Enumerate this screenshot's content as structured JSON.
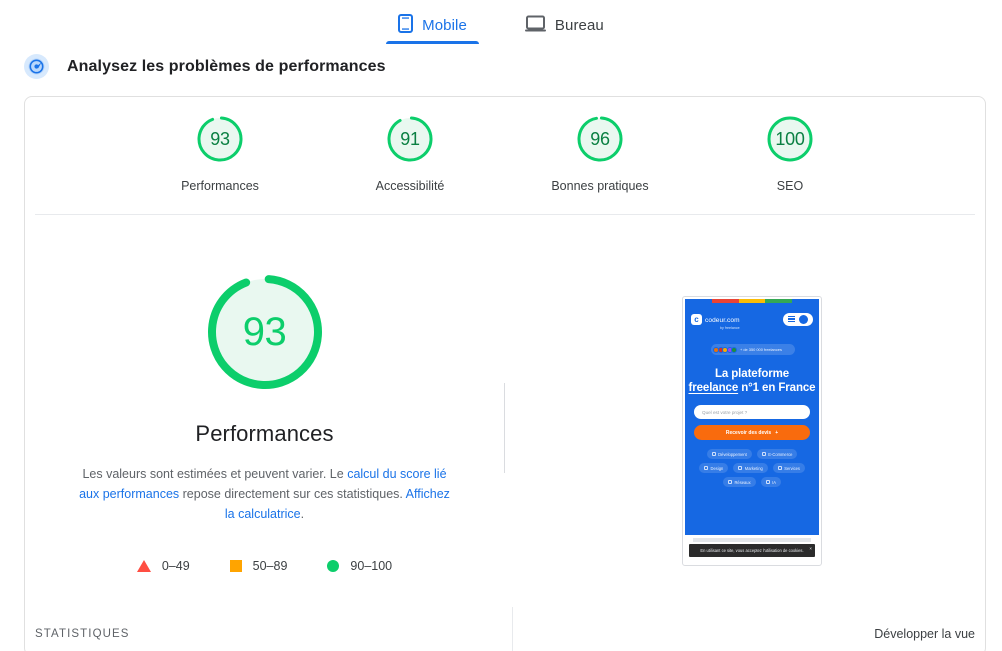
{
  "tabs": [
    {
      "label": "Mobile",
      "icon": "phone-icon",
      "active": true
    },
    {
      "label": "Bureau",
      "icon": "desktop-icon",
      "active": false
    }
  ],
  "section": {
    "icon": "performance-gauge-icon",
    "title": "Analysez les problèmes de performances"
  },
  "scores": [
    {
      "value": "93",
      "label": "Performances"
    },
    {
      "value": "91",
      "label": "Accessibilité"
    },
    {
      "value": "96",
      "label": "Bonnes pratiques"
    },
    {
      "value": "100",
      "label": "SEO"
    }
  ],
  "main": {
    "gauge_value": "93",
    "gauge_number": 93,
    "title": "Performances",
    "description": {
      "part1": "Les valeurs sont estimées et peuvent varier. Le ",
      "link1": "calcul du score lié aux performances",
      "part2": " repose directement sur ces statistiques. ",
      "link2": "Affichez la calculatrice",
      "part3": "."
    }
  },
  "legend": [
    {
      "shape": "triangle",
      "range": "0–49",
      "color": "#ff4e42"
    },
    {
      "shape": "square",
      "range": "50–89",
      "color": "#ffa400"
    },
    {
      "shape": "circle",
      "range": "90–100",
      "color": "#0cce6b"
    }
  ],
  "thumbnail": {
    "alt": "screenshot-mobile-page",
    "logo_text": "codeur.com",
    "logo_mark": "c",
    "logo_sub": "by freelance",
    "badge_text": "+ de 350 000 freelances",
    "headline_line1": "La plateforme",
    "headline_underlined": "freelance",
    "headline_rest": " n°1 en France",
    "search_placeholder": "Quel est votre projet ?",
    "cta_label": "Recevoir des devis",
    "cta_icon": "+",
    "chips": [
      "Développement",
      "E-Commerce",
      "Design",
      "Marketing",
      "Services",
      "Réseaux",
      "IA"
    ],
    "cookie_text": "En utilisant ce site, vous acceptez l'utilisation de cookies.",
    "cookie_close": "×"
  },
  "footer": {
    "stats_label": "STATISTIQUES",
    "expand_label": "Développer la vue"
  },
  "colors": {
    "green": "#0cce6b",
    "green_fill": "#e9f8f0",
    "green_text": "#0b8043",
    "orange": "#ffa400",
    "red": "#ff4e42",
    "blue": "#1a73e8",
    "brand_blue": "#1668e3",
    "cta_orange": "#f96b0d"
  }
}
